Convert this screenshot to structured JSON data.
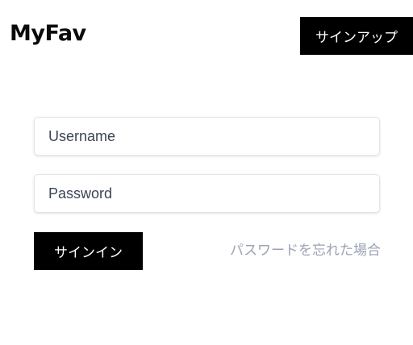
{
  "header": {
    "logo_text": "MyFav",
    "signup_label": "サインアップ"
  },
  "form": {
    "username": {
      "placeholder": "Username",
      "value": ""
    },
    "password": {
      "placeholder": "Password",
      "value": ""
    },
    "signin_label": "サインイン",
    "forgot_label": "パスワードを忘れた場合"
  },
  "colors": {
    "background": "#ffffff",
    "button_bg": "#000000",
    "button_text": "#ffffff",
    "link_text": "#9aa2b2",
    "field_border": "#e2e4e8"
  }
}
